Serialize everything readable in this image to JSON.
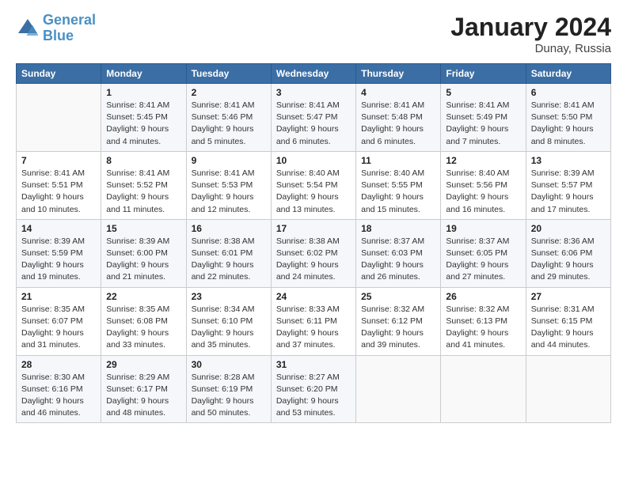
{
  "header": {
    "logo_line1": "General",
    "logo_line2": "Blue",
    "month_title": "January 2024",
    "location": "Dunay, Russia"
  },
  "columns": [
    "Sunday",
    "Monday",
    "Tuesday",
    "Wednesday",
    "Thursday",
    "Friday",
    "Saturday"
  ],
  "weeks": [
    [
      {
        "day": "",
        "sunrise": "",
        "sunset": "",
        "daylight": ""
      },
      {
        "day": "1",
        "sunrise": "Sunrise: 8:41 AM",
        "sunset": "Sunset: 5:45 PM",
        "daylight": "Daylight: 9 hours and 4 minutes."
      },
      {
        "day": "2",
        "sunrise": "Sunrise: 8:41 AM",
        "sunset": "Sunset: 5:46 PM",
        "daylight": "Daylight: 9 hours and 5 minutes."
      },
      {
        "day": "3",
        "sunrise": "Sunrise: 8:41 AM",
        "sunset": "Sunset: 5:47 PM",
        "daylight": "Daylight: 9 hours and 6 minutes."
      },
      {
        "day": "4",
        "sunrise": "Sunrise: 8:41 AM",
        "sunset": "Sunset: 5:48 PM",
        "daylight": "Daylight: 9 hours and 6 minutes."
      },
      {
        "day": "5",
        "sunrise": "Sunrise: 8:41 AM",
        "sunset": "Sunset: 5:49 PM",
        "daylight": "Daylight: 9 hours and 7 minutes."
      },
      {
        "day": "6",
        "sunrise": "Sunrise: 8:41 AM",
        "sunset": "Sunset: 5:50 PM",
        "daylight": "Daylight: 9 hours and 8 minutes."
      }
    ],
    [
      {
        "day": "7",
        "sunrise": "Sunrise: 8:41 AM",
        "sunset": "Sunset: 5:51 PM",
        "daylight": "Daylight: 9 hours and 10 minutes."
      },
      {
        "day": "8",
        "sunrise": "Sunrise: 8:41 AM",
        "sunset": "Sunset: 5:52 PM",
        "daylight": "Daylight: 9 hours and 11 minutes."
      },
      {
        "day": "9",
        "sunrise": "Sunrise: 8:41 AM",
        "sunset": "Sunset: 5:53 PM",
        "daylight": "Daylight: 9 hours and 12 minutes."
      },
      {
        "day": "10",
        "sunrise": "Sunrise: 8:40 AM",
        "sunset": "Sunset: 5:54 PM",
        "daylight": "Daylight: 9 hours and 13 minutes."
      },
      {
        "day": "11",
        "sunrise": "Sunrise: 8:40 AM",
        "sunset": "Sunset: 5:55 PM",
        "daylight": "Daylight: 9 hours and 15 minutes."
      },
      {
        "day": "12",
        "sunrise": "Sunrise: 8:40 AM",
        "sunset": "Sunset: 5:56 PM",
        "daylight": "Daylight: 9 hours and 16 minutes."
      },
      {
        "day": "13",
        "sunrise": "Sunrise: 8:39 AM",
        "sunset": "Sunset: 5:57 PM",
        "daylight": "Daylight: 9 hours and 17 minutes."
      }
    ],
    [
      {
        "day": "14",
        "sunrise": "Sunrise: 8:39 AM",
        "sunset": "Sunset: 5:59 PM",
        "daylight": "Daylight: 9 hours and 19 minutes."
      },
      {
        "day": "15",
        "sunrise": "Sunrise: 8:39 AM",
        "sunset": "Sunset: 6:00 PM",
        "daylight": "Daylight: 9 hours and 21 minutes."
      },
      {
        "day": "16",
        "sunrise": "Sunrise: 8:38 AM",
        "sunset": "Sunset: 6:01 PM",
        "daylight": "Daylight: 9 hours and 22 minutes."
      },
      {
        "day": "17",
        "sunrise": "Sunrise: 8:38 AM",
        "sunset": "Sunset: 6:02 PM",
        "daylight": "Daylight: 9 hours and 24 minutes."
      },
      {
        "day": "18",
        "sunrise": "Sunrise: 8:37 AM",
        "sunset": "Sunset: 6:03 PM",
        "daylight": "Daylight: 9 hours and 26 minutes."
      },
      {
        "day": "19",
        "sunrise": "Sunrise: 8:37 AM",
        "sunset": "Sunset: 6:05 PM",
        "daylight": "Daylight: 9 hours and 27 minutes."
      },
      {
        "day": "20",
        "sunrise": "Sunrise: 8:36 AM",
        "sunset": "Sunset: 6:06 PM",
        "daylight": "Daylight: 9 hours and 29 minutes."
      }
    ],
    [
      {
        "day": "21",
        "sunrise": "Sunrise: 8:35 AM",
        "sunset": "Sunset: 6:07 PM",
        "daylight": "Daylight: 9 hours and 31 minutes."
      },
      {
        "day": "22",
        "sunrise": "Sunrise: 8:35 AM",
        "sunset": "Sunset: 6:08 PM",
        "daylight": "Daylight: 9 hours and 33 minutes."
      },
      {
        "day": "23",
        "sunrise": "Sunrise: 8:34 AM",
        "sunset": "Sunset: 6:10 PM",
        "daylight": "Daylight: 9 hours and 35 minutes."
      },
      {
        "day": "24",
        "sunrise": "Sunrise: 8:33 AM",
        "sunset": "Sunset: 6:11 PM",
        "daylight": "Daylight: 9 hours and 37 minutes."
      },
      {
        "day": "25",
        "sunrise": "Sunrise: 8:32 AM",
        "sunset": "Sunset: 6:12 PM",
        "daylight": "Daylight: 9 hours and 39 minutes."
      },
      {
        "day": "26",
        "sunrise": "Sunrise: 8:32 AM",
        "sunset": "Sunset: 6:13 PM",
        "daylight": "Daylight: 9 hours and 41 minutes."
      },
      {
        "day": "27",
        "sunrise": "Sunrise: 8:31 AM",
        "sunset": "Sunset: 6:15 PM",
        "daylight": "Daylight: 9 hours and 44 minutes."
      }
    ],
    [
      {
        "day": "28",
        "sunrise": "Sunrise: 8:30 AM",
        "sunset": "Sunset: 6:16 PM",
        "daylight": "Daylight: 9 hours and 46 minutes."
      },
      {
        "day": "29",
        "sunrise": "Sunrise: 8:29 AM",
        "sunset": "Sunset: 6:17 PM",
        "daylight": "Daylight: 9 hours and 48 minutes."
      },
      {
        "day": "30",
        "sunrise": "Sunrise: 8:28 AM",
        "sunset": "Sunset: 6:19 PM",
        "daylight": "Daylight: 9 hours and 50 minutes."
      },
      {
        "day": "31",
        "sunrise": "Sunrise: 8:27 AM",
        "sunset": "Sunset: 6:20 PM",
        "daylight": "Daylight: 9 hours and 53 minutes."
      },
      {
        "day": "",
        "sunrise": "",
        "sunset": "",
        "daylight": ""
      },
      {
        "day": "",
        "sunrise": "",
        "sunset": "",
        "daylight": ""
      },
      {
        "day": "",
        "sunrise": "",
        "sunset": "",
        "daylight": ""
      }
    ]
  ]
}
